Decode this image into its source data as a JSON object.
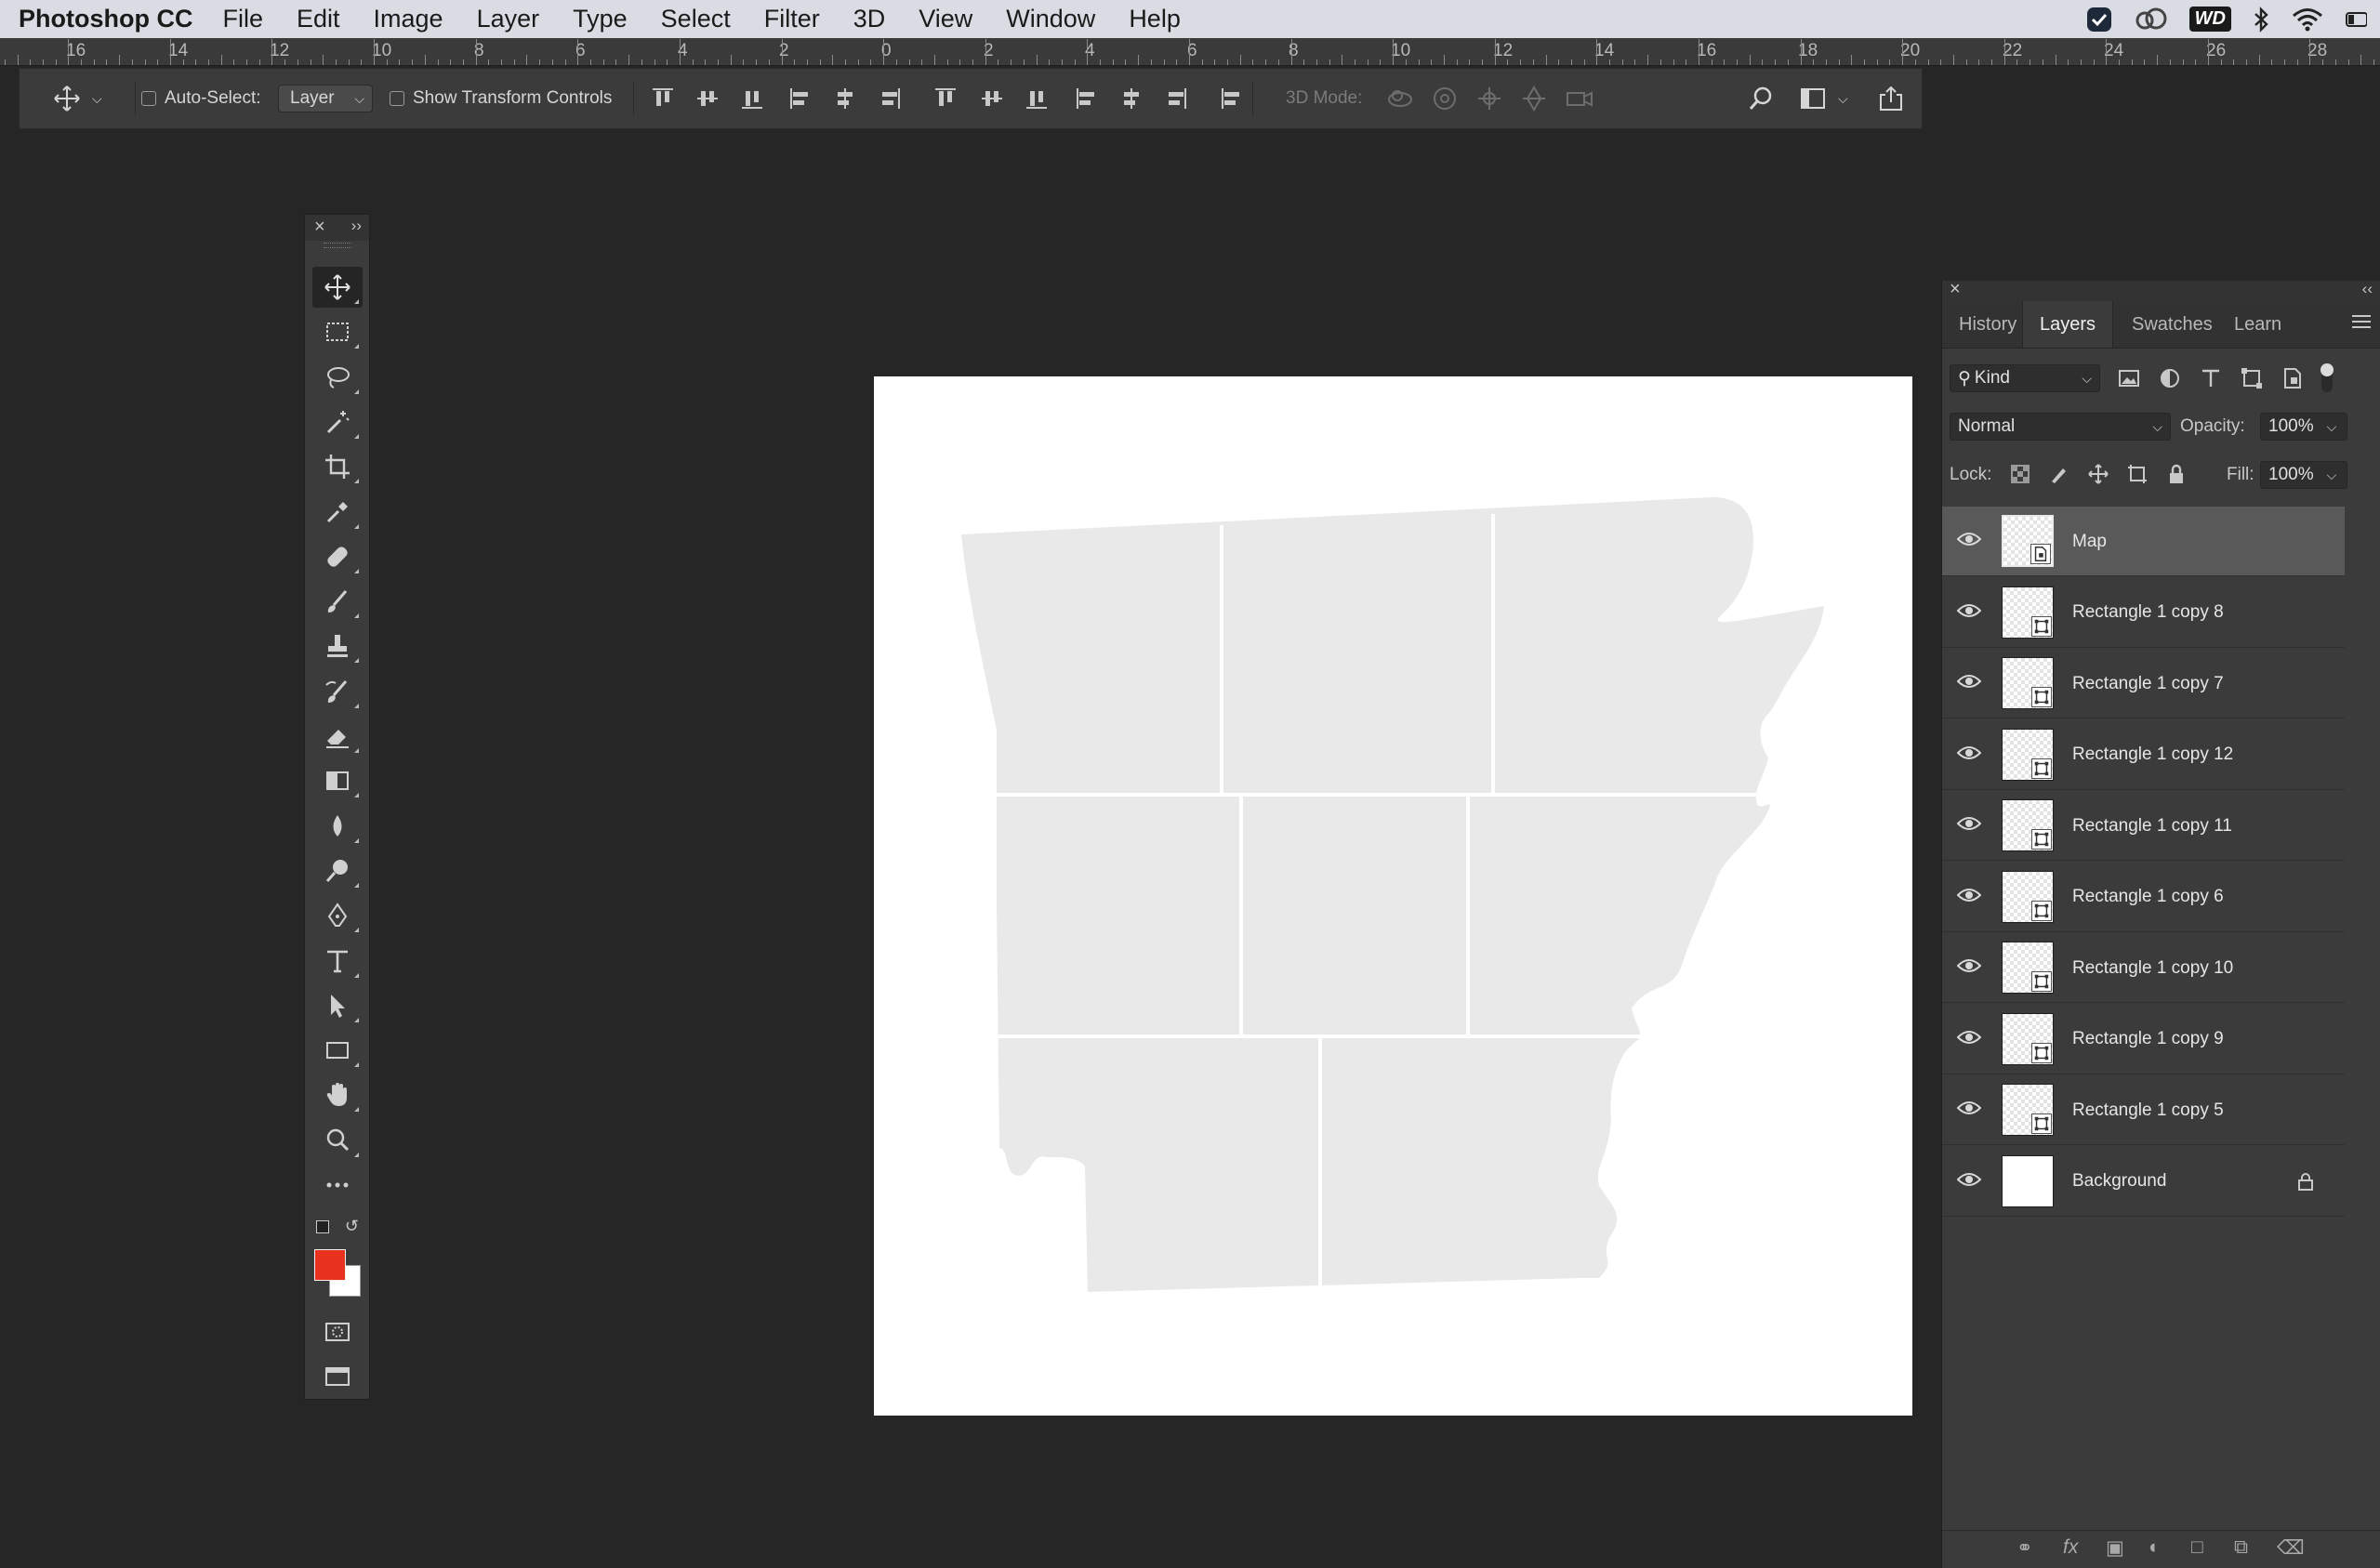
{
  "menubar": {
    "app_name": "Photoshop CC",
    "items": [
      "File",
      "Edit",
      "Image",
      "Layer",
      "Type",
      "Select",
      "Filter",
      "3D",
      "View",
      "Window",
      "Help"
    ],
    "status_badge": "WD"
  },
  "ruler": {
    "labels": [
      "16",
      "14",
      "12",
      "10",
      "8",
      "6",
      "4",
      "2",
      "0",
      "2",
      "4",
      "6",
      "8",
      "10",
      "12",
      "14",
      "16",
      "18",
      "20",
      "22",
      "24",
      "26",
      "28"
    ]
  },
  "options_bar": {
    "auto_select_label": "Auto-Select:",
    "auto_select_value": "Layer",
    "show_transform_label": "Show Transform Controls",
    "mode_3d_label": "3D Mode:"
  },
  "tools": {
    "items": [
      "move-tool",
      "marquee-tool",
      "lasso-tool",
      "magic-wand-tool",
      "crop-tool",
      "eyedropper-tool",
      "healing-brush-tool",
      "brush-tool",
      "clone-stamp-tool",
      "history-brush-tool",
      "eraser-tool",
      "gradient-tool",
      "blur-tool",
      "dodge-tool",
      "pen-tool",
      "type-tool",
      "path-selection-tool",
      "rectangle-tool",
      "hand-tool",
      "zoom-tool",
      "more-tools"
    ],
    "foreground_color": "#e8321d",
    "background_color": "#ffffff"
  },
  "canvas": {
    "background": "#ffffff",
    "map_fill": "#e9e9e9",
    "divider_color": "#ffffff"
  },
  "layers_panel": {
    "tabs": [
      "History",
      "Layers",
      "Swatches",
      "Learn"
    ],
    "active_tab": "Layers",
    "filter_kind": "Kind",
    "blend_mode": "Normal",
    "opacity_label": "Opacity:",
    "opacity_value": "100%",
    "lock_label": "Lock:",
    "fill_label": "Fill:",
    "fill_value": "100%",
    "layers": [
      {
        "name": "Map",
        "selected": true,
        "type": "smart"
      },
      {
        "name": "Rectangle 1 copy 8",
        "type": "shape"
      },
      {
        "name": "Rectangle 1 copy 7",
        "type": "shape"
      },
      {
        "name": "Rectangle 1 copy 12",
        "type": "shape"
      },
      {
        "name": "Rectangle 1 copy 11",
        "type": "shape"
      },
      {
        "name": "Rectangle 1 copy 6",
        "type": "shape"
      },
      {
        "name": "Rectangle 1 copy 10",
        "type": "shape"
      },
      {
        "name": "Rectangle 1 copy 9",
        "type": "shape"
      },
      {
        "name": "Rectangle 1 copy 5",
        "type": "shape"
      },
      {
        "name": "Background",
        "type": "background",
        "locked": true
      }
    ]
  }
}
